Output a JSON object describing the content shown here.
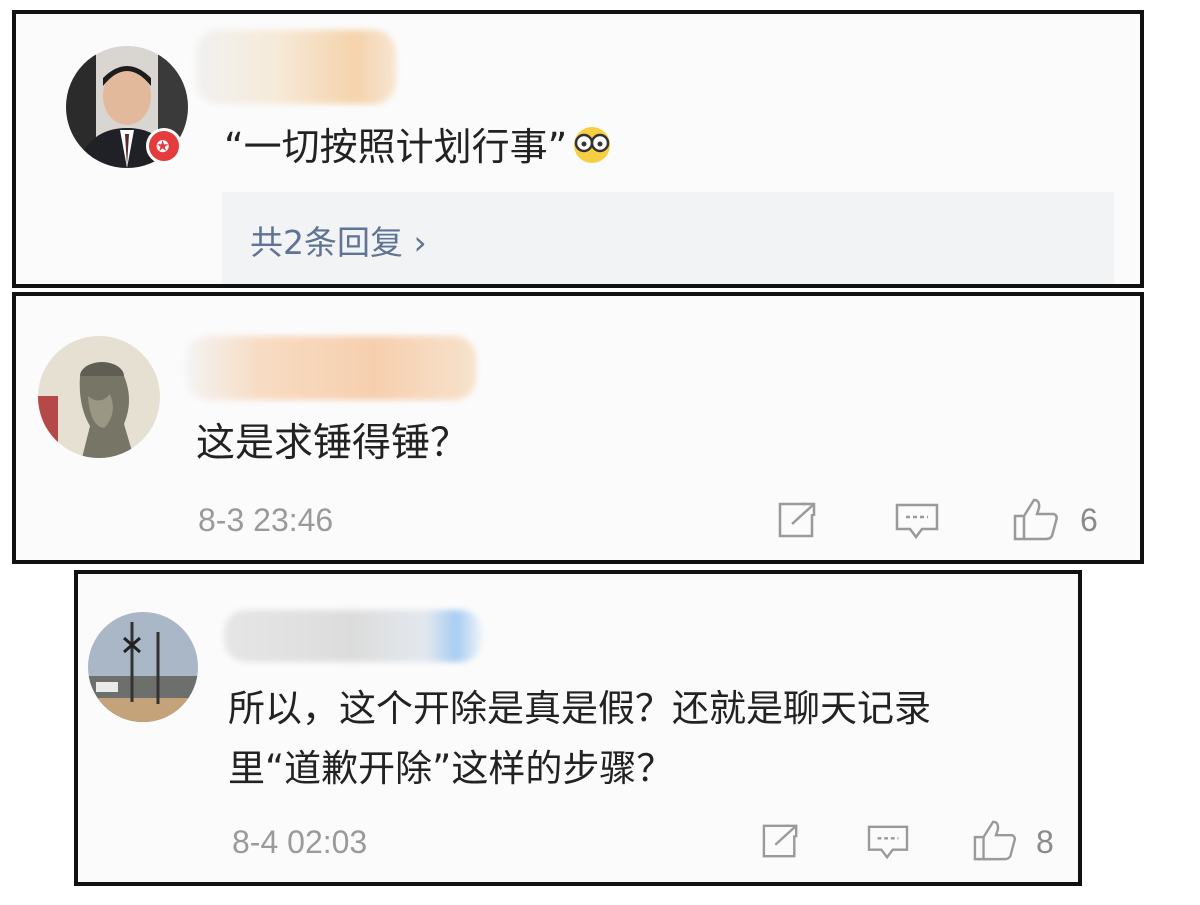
{
  "comments": [
    {
      "text": "“一切按照计划行事”",
      "emoji_icon": "glasses-face-emoji",
      "replies_label": "共2条回复 ›",
      "verified_badge": "verified-v-icon"
    },
    {
      "text": "这是求锤得锤？",
      "timestamp": "8-3 23:46",
      "likes": "6"
    },
    {
      "text_line1": "所以，这个开除是真是假？还就是聊天记录",
      "text_line2": "里“道歉开除”这样的步骤？",
      "timestamp": "8-4 02:03",
      "likes": "8"
    }
  ],
  "icons": [
    "share-icon",
    "comment-icon",
    "like-icon"
  ],
  "colors": {
    "border": "#111111",
    "meta_text": "#9a9a9a",
    "reply_link": "#5f7394",
    "badge": "#e43c3c"
  }
}
